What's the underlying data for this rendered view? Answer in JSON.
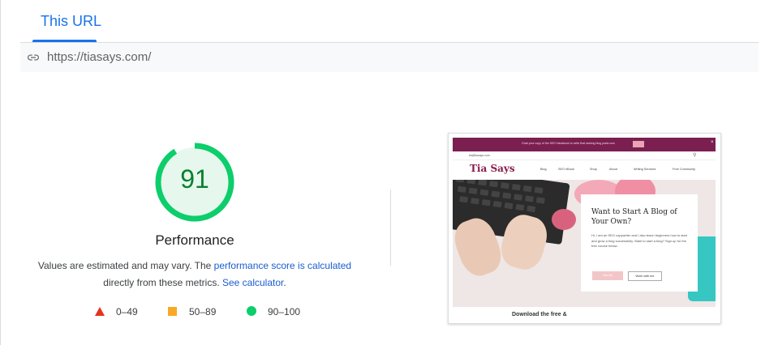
{
  "tabs": {
    "active_label": "This URL"
  },
  "url_bar": {
    "url": "https://tiasays.com/",
    "icon": "link-icon"
  },
  "performance": {
    "score": 91,
    "score_fraction": 0.91,
    "title": "Performance",
    "description_prefix": "Values are estimated and may vary. The ",
    "score_link": "performance score is calculated",
    "description_middle": "directly from these metrics. ",
    "calc_link": "See calculator",
    "description_suffix": ".",
    "colors": {
      "pass": "#0cce6b",
      "pass_text": "#0a7f2e",
      "average": "#f9a825",
      "fail": "#e8321f"
    }
  },
  "legend": [
    {
      "icon": "red-triangle-icon",
      "range": "0–49"
    },
    {
      "icon": "orange-square-icon",
      "range": "50–89"
    },
    {
      "icon": "green-circle-icon",
      "range": "90–100"
    }
  ],
  "screenshot": {
    "top_banner": "Grab your copy of the SEO Handbook to write that ranking blog posts now",
    "email": "tia@tiasays.com",
    "logo": "Tia Says",
    "nav": [
      "Blog",
      "SEO eBook",
      "Shop",
      "About",
      "Writing Services",
      "Free Community"
    ],
    "card_title": "Want to Start A Blog of Your Own?",
    "card_body": "Hi, I am an SEO copywriter and I also teach beginners how to start and grow a blog successfully. Want to start a blog? Sign up for the free course below.",
    "card_button_1": "Join Us",
    "card_button_2": "Work with me",
    "bottom_text": "Download the free &"
  }
}
